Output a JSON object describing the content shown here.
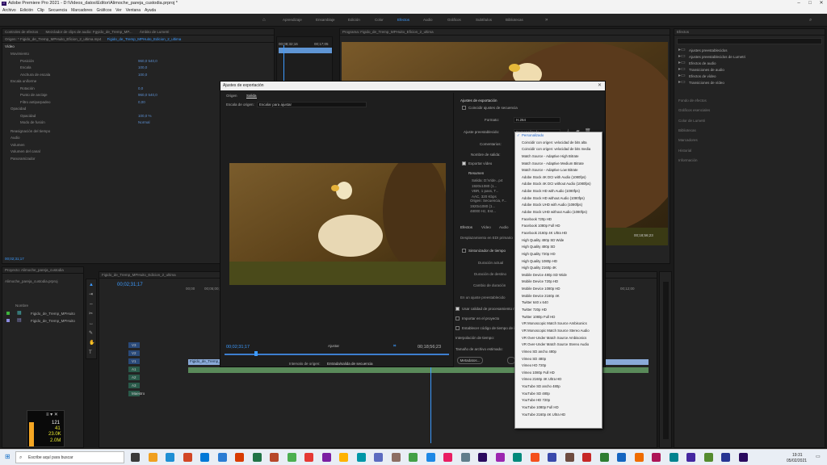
{
  "app": {
    "title": "Adobe Premiere Pro 2021 - D:\\Videos_datos\\Editor\\Alimoche_pareja_custodia.prproj *",
    "menu": [
      "Archivo",
      "Edición",
      "Clip",
      "Secuencia",
      "Marcadores",
      "Gráficos",
      "Ver",
      "Ventana",
      "Ayuda"
    ]
  },
  "workspaces": [
    "Aprendizaje",
    "Ensamblaje",
    "Edición",
    "Color",
    "Efectos",
    "Audio",
    "Gráficos",
    "Subtítulos",
    "Bibliotecas"
  ],
  "active_workspace": "Efectos",
  "source_panel": {
    "tabs": [
      "Controles de efectos",
      "Mezclador de clips de audio: Fgyido_de_Tremp_MP...",
      "Ámbito de Lumetri"
    ],
    "breadcrumb": "Origen: * Figido_de_Tremp_MPHuito_Eficion_2_ultima.mp4",
    "clip": "Figido_de_Tremp_MPHuito_Edicion_2_ultima",
    "timecode_a": "00;08;32;16",
    "timecode_b": "00;17;05",
    "video_label": "Vídeo",
    "properties": [
      {
        "name": "Movimiento",
        "value": ""
      },
      {
        "name": "Posición",
        "value": "960,0    540,0"
      },
      {
        "name": "Escala",
        "value": "100,0"
      },
      {
        "name": "Anchura de escala",
        "value": "100,0"
      },
      {
        "name": "Escala uniforme",
        "value": ""
      },
      {
        "name": "Rotación",
        "value": "0,0"
      },
      {
        "name": "Punto de anclaje",
        "value": "960,0    540,0"
      },
      {
        "name": "Filtro antiparpadeo",
        "value": "0,00"
      },
      {
        "name": "Opacidad",
        "value": ""
      },
      {
        "name": "Opacidad",
        "value": "100,0 %"
      },
      {
        "name": "Modo de fusión",
        "value": "Normal"
      },
      {
        "name": "Reasignación del tiempo",
        "value": ""
      },
      {
        "name": "Audio",
        "value": ""
      },
      {
        "name": "Volumen",
        "value": ""
      },
      {
        "name": "Volumen del canal",
        "value": ""
      },
      {
        "name": "Panoramizador",
        "value": ""
      }
    ],
    "bottom_timecode": "00;02;31;17"
  },
  "program": {
    "header": "Programa: Figido_de_Tremp_MPHuito_Eficion_2_ultima",
    "timecode_right": "00;18;56;23"
  },
  "effects_panel": {
    "title": "Efectos",
    "items": [
      "Ajustes preestablecidos",
      "Ajustes preestablecidos de Lumetri",
      "Efectos de audio",
      "Transiciones de audio",
      "Efectos de vídeo",
      "Transiciones de vídeo"
    ],
    "sections": [
      "Fondo de efectos",
      "Gráficos esenciales",
      "Color de Lumetri",
      "Bibliotecas",
      "Marcadores",
      "Historial",
      "Información"
    ]
  },
  "project_panel": {
    "title": "Proyecto: Alimoche_pareja_custodia",
    "file": "Alimoche_pareja_custodia.prproj",
    "list_header": "Nombre",
    "items": [
      "Figido_de_Tremp_MPHuito",
      "Figido_de_Tremp_MPHuito"
    ]
  },
  "timeline": {
    "title": "Figido_de_Tremp_MPHuito_Edicion_2_ultima",
    "timecode": "00;02;31;17",
    "ruler": [
      "00;00",
      "00;05;00;00",
      "00;10;00",
      "00;15;00;00",
      "00;12;00"
    ],
    "tracks": [
      "V3",
      "V2",
      "V1",
      "A1",
      "A2",
      "A3",
      "Maestro"
    ],
    "clip_label": "Figido_de_Tremp_MPHuito"
  },
  "perf_overlay": {
    "fps": "121",
    "v2": "41",
    "v3": "23.0K",
    "v4": "2.0M"
  },
  "export_dialog": {
    "title": "Ajustes de exportación",
    "tabs": [
      "Origen",
      "Salida"
    ],
    "scale_label": "Escala de origen:",
    "scale_value": "Escalar para ajustar",
    "timecode_in": "00;02;31;17",
    "timecode_out": "00;18;56;23",
    "fit_label": "Ajustar",
    "range_label": "Intervalo de origen:",
    "range_value": "Entrada/salida de secuencia",
    "export_settings": "Ajustes de exportación",
    "match_seq": "Coincidir ajustes de secuencia",
    "format_label": "Formato:",
    "format_value": "H.264",
    "preset_label": "Ajuste preestablecido:",
    "preset_value": "Personalizado",
    "comments_label": "Comentarios:",
    "output_label": "Nombre de salida:",
    "export_video": "Exportar vídeo",
    "summary": "Resumen",
    "output_summary": "Salida: D:\\Vide...p4\n1920x1080 (1...\nVBR, 1 pass, T...\nAAC, 320 Kbps",
    "source_summary": "Origen: Secuencia, F...\n1920x1080 (1...\n48000 Hz, Est...",
    "subtabs": [
      "Efectos",
      "Vídeo",
      "Audio"
    ],
    "hdr_label": "Desplazamiento en EDI primario",
    "timeline_label": "Sintonizador de tiempo",
    "duration_label": "Duración actual",
    "duration2": "Duración de destino",
    "speed_label": "Cambio de duración",
    "preset_alt": "En un ajuste preestablecido",
    "max_quality": "Usar calidad de procesamiento máxima",
    "import_project": "Importar en el proyecto",
    "set_start": "Establecer código de tiempo de inicio",
    "interp_label": "Interpolación de tiempo:",
    "interp_value": "Muestreo de fotogramas",
    "filesize_label": "Tamaño de archivo estimado:",
    "metadata_btn": "Metadatos...",
    "presets": [
      "Personalizado",
      "Coincidir con origen: velocidad de bits alta",
      "Coincidir con origen: velocidad de bits media",
      "Match Source - Adaptive High Bitrate",
      "Match Source - Adaptive Medium Bitrate",
      "Match Source - Adaptive Low Bitrate",
      "Adobe Stock 4K DCI with Audio (1080fps)",
      "Adobe Stock 4K DCI without Audio (1080fps)",
      "Adobe Stock HD with Audio (1080fps)",
      "Adobe Stock HD without Audio (1080fps)",
      "Adobe Stock UHD with Audio (1080fps)",
      "Adobe Stock UHD without Audio (1080fps)",
      "Facebook 720p HD",
      "Facebook 1080p Full HD",
      "Facebook 2160p 4K Ultra HD",
      "High Quality 480p SD Wide",
      "High Quality 480p SD",
      "High Quality 720p HD",
      "High Quality 1080p HD",
      "High Quality 2160p 4K",
      "Mobile Device 480p SD Wide",
      "Mobile Device 720p HD",
      "Mobile Device 1080p HD",
      "Mobile Device 2160p 4K",
      "Twitter 640 x 640",
      "Twitter 720p HD",
      "Twitter 1080p Full HD",
      "VR Monoscopic Match Source Ambisonics",
      "VR Monoscopic Match Source Stereo Audio",
      "VR Over-Under Match Source Ambisonics",
      "VR Over-Under Match Source Stereo Audio",
      "Vimeo SD ancho 480p",
      "Vimeo SD 480p",
      "Vimeo HD 720p",
      "Vimeo 1080p Full HD",
      "Vimeo 2160p 4K Ultra HD",
      "YouTube SD ancho 480p",
      "YouTube SD 480p",
      "YouTube HD 720p",
      "YouTube 1080p Full HD",
      "YouTube 2160p 4K Ultra HD"
    ]
  },
  "taskbar": {
    "search_placeholder": "Escribe aquí para buscar",
    "time": "19:31",
    "date": "05/02/2021"
  },
  "colors": {
    "accent": "#3d9bff",
    "panel": "#232323",
    "bg": "#1a1a1a"
  }
}
